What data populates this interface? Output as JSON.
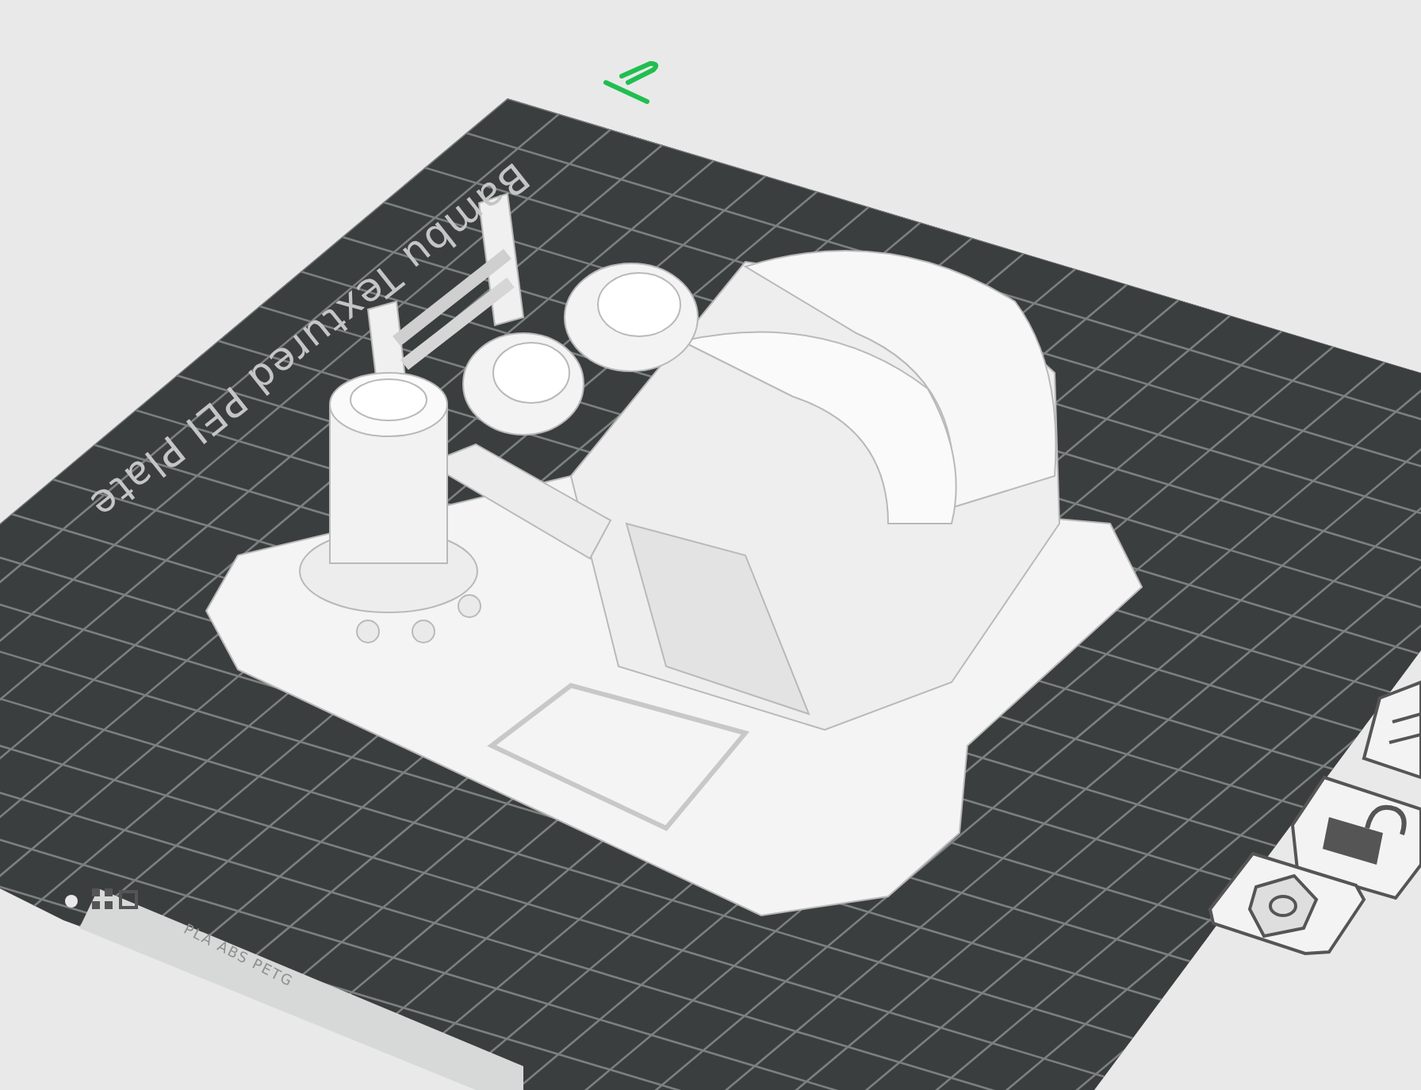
{
  "build_plate": {
    "label": "Bambu Textured PEI Plate",
    "filament_types": "PLA ABS PETG"
  }
}
